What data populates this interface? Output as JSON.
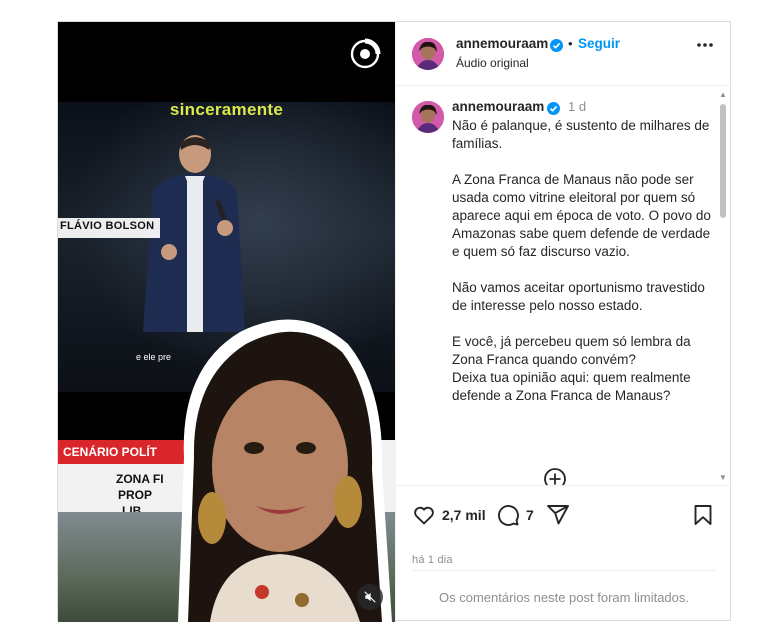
{
  "author": {
    "username": "annemouraam",
    "follow_label": "Seguir",
    "separator": "•",
    "audio_label": "Áudio original"
  },
  "media": {
    "caption_word": "sinceramente",
    "lower_third": "FLÁVIO BOLSON",
    "subtitle": "e ele pre",
    "news_tag": "CENÁRIO POLÍT",
    "news_lines": [
      "ZONA FI",
      "PROP",
      "LIB"
    ]
  },
  "comment": {
    "username": "annemouraam",
    "time": "1 d",
    "paragraphs": [
      "Não é palanque, é sustento de milhares de famílias.",
      "A Zona Franca de Manaus não pode ser usada como vitrine eleitoral por quem só aparece aqui em época de voto. O povo do Amazonas sabe quem defende de verdade e quem só faz discurso vazio.",
      "Não vamos aceitar oportunismo travestido de interesse pelo nosso estado.",
      "E você, já percebeu quem só lembra da Zona Franca quando convém?",
      "Deixa tua opinião aqui: quem realmente defende a Zona Franca de Manaus?"
    ]
  },
  "actions": {
    "likes": "2,7 mil",
    "comments": "7",
    "posted": "há 1 dia",
    "limited_notice": "Os comentários neste post foram limitados."
  },
  "colors": {
    "accent": "#0095f6",
    "news_red": "#d8262b",
    "caption_yellow": "#d9ea4a"
  },
  "icons": [
    "reels-icon",
    "more-icon",
    "verified-icon",
    "heart-icon",
    "comment-icon",
    "share-icon",
    "bookmark-icon",
    "load-more-icon",
    "muted-icon"
  ]
}
